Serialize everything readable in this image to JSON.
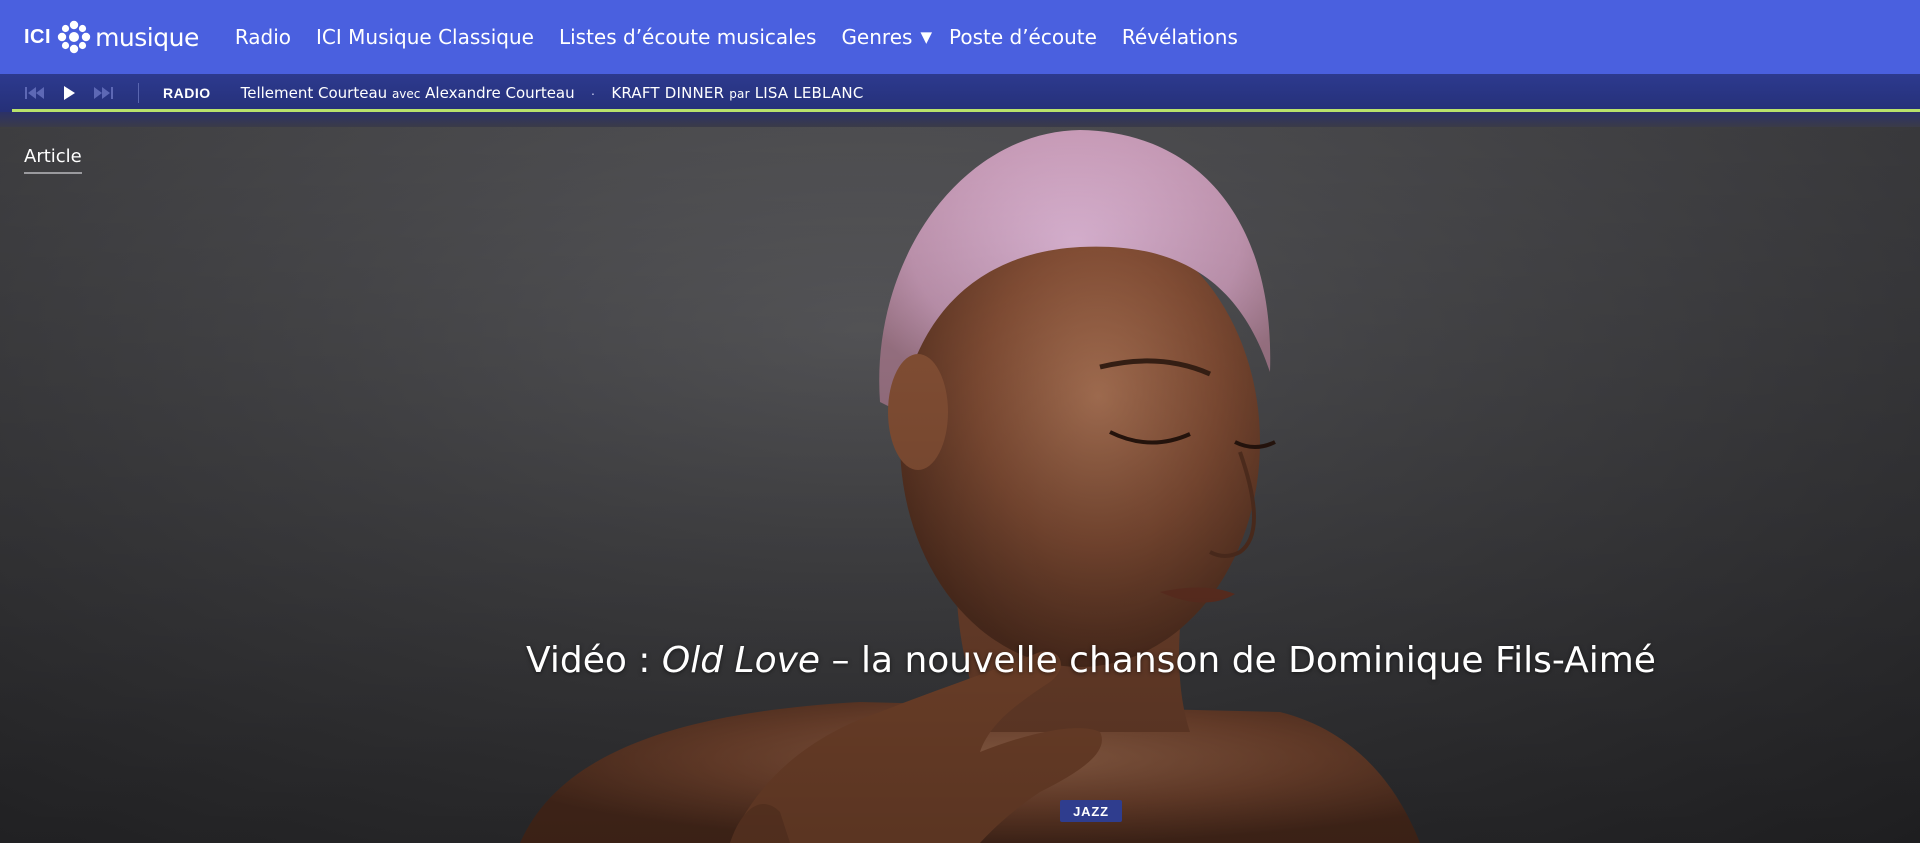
{
  "logo": {
    "ici": "ICI",
    "name": "musique"
  },
  "nav": {
    "items": [
      {
        "label": "Radio"
      },
      {
        "label": "ICI Musique Classique"
      },
      {
        "label": "Listes d’écoute musicales"
      },
      {
        "label": "Genres",
        "caret": "▼"
      },
      {
        "label": "Poste d’écoute"
      },
      {
        "label": "Révélations"
      }
    ]
  },
  "player": {
    "controls": [
      "skip-back-icon",
      "play-icon",
      "skip-forward-icon"
    ],
    "tag": "RADIO",
    "show_title": "Tellement Courteau",
    "show_connector": "avec",
    "show_host": "Alexandre Courteau",
    "separator": "·",
    "track_title": "KRAFT DINNER",
    "track_connector": "par",
    "track_artist": "LISA LEBLANC"
  },
  "hero": {
    "section_label": "Article",
    "headline_prefix": "Vidéo : ",
    "headline_italic": "Old Love",
    "headline_suffix": " – la nouvelle chanson de Dominique Fils-Aimé",
    "genre": "JAZZ"
  },
  "colors": {
    "nav_bg": "#4a60df",
    "player_bg": "#2d3a8f",
    "progress": "#b9e26b",
    "badge_bg": "#2f3d8e"
  }
}
